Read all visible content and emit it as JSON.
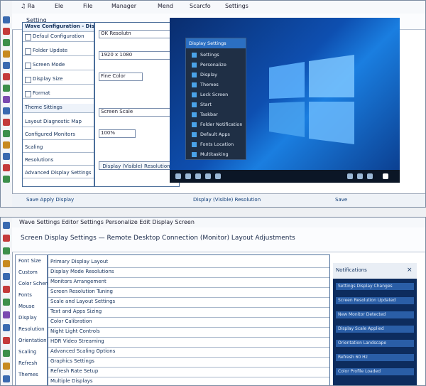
{
  "top": {
    "title_items": [
      "♫ Ra",
      "Ele",
      "File",
      "Manager",
      "Mend",
      "Scarcfo",
      "Settings"
    ],
    "tabs": [
      "Setting"
    ],
    "left_form_title": "Wave Configuration - Display Settings",
    "left_form_rows": [
      "Defaul Configuration",
      "Folder Update",
      "Screen Mode",
      "Display Size",
      "Format",
      "Theme Sittings",
      "Layout Diagnostic Map",
      "Configured Monitors",
      "Scaling",
      "Resolutions",
      "Advanced Display Settings"
    ],
    "mid_fields": [
      "OK Resolutn",
      "1920 x 1080",
      "Fine Color",
      "Screen Scale",
      "100%"
    ],
    "status_left": "Save   Apply   Display",
    "status_right": "Save",
    "display_button": "Display (Visible) Resolution",
    "desktop_menu_items": [
      "Settings",
      "Personalize",
      "Display",
      "Themes",
      "Lock Screen",
      "Start",
      "Taskbar",
      "Folder Notification",
      "Default Apps",
      "Fonts Location",
      "Multitasking"
    ],
    "desktop_menu_title": "Display Settings"
  },
  "bottom": {
    "title_line": "Wave Settings  Editor  Settings  Personalize  Edit  Display Screen",
    "header_line": "Screen Display Settings — Remote Desktop Connection (Monitor) Layout Adjustments",
    "left_labels": [
      "Font Size",
      "Custom",
      "Color Scheme",
      "Fonts",
      "Mouse",
      "Display",
      "Resolution",
      "Orientation",
      "Scaling",
      "Refresh",
      "Themes"
    ],
    "mid_rows": [
      "Primary Display Layout",
      "Display Mode Resolutions",
      "Monitors Arrangement",
      "Screen Resolution Tuning",
      "Scale and Layout Settings",
      "Text and Apps Sizing",
      "Color Calibration",
      "Night Light Controls",
      "HDR Video Streaming",
      "Advanced Scaling Options",
      "Graphics Settings",
      "Refresh Rate Setup",
      "Multiple Displays"
    ],
    "right_panel_title": "Notifications",
    "right_panel_items": [
      "Settings Display Changes",
      "Screen Resolution Updated",
      "New Monitor Detected",
      "Display Scale Applied",
      "Orientation Landscape",
      "Refresh 60 Hz",
      "Color Profile Loaded"
    ]
  },
  "colors": {
    "accent": "#2b6fc2",
    "desktop": "#0a3a8a",
    "alert": "#c0202a"
  }
}
